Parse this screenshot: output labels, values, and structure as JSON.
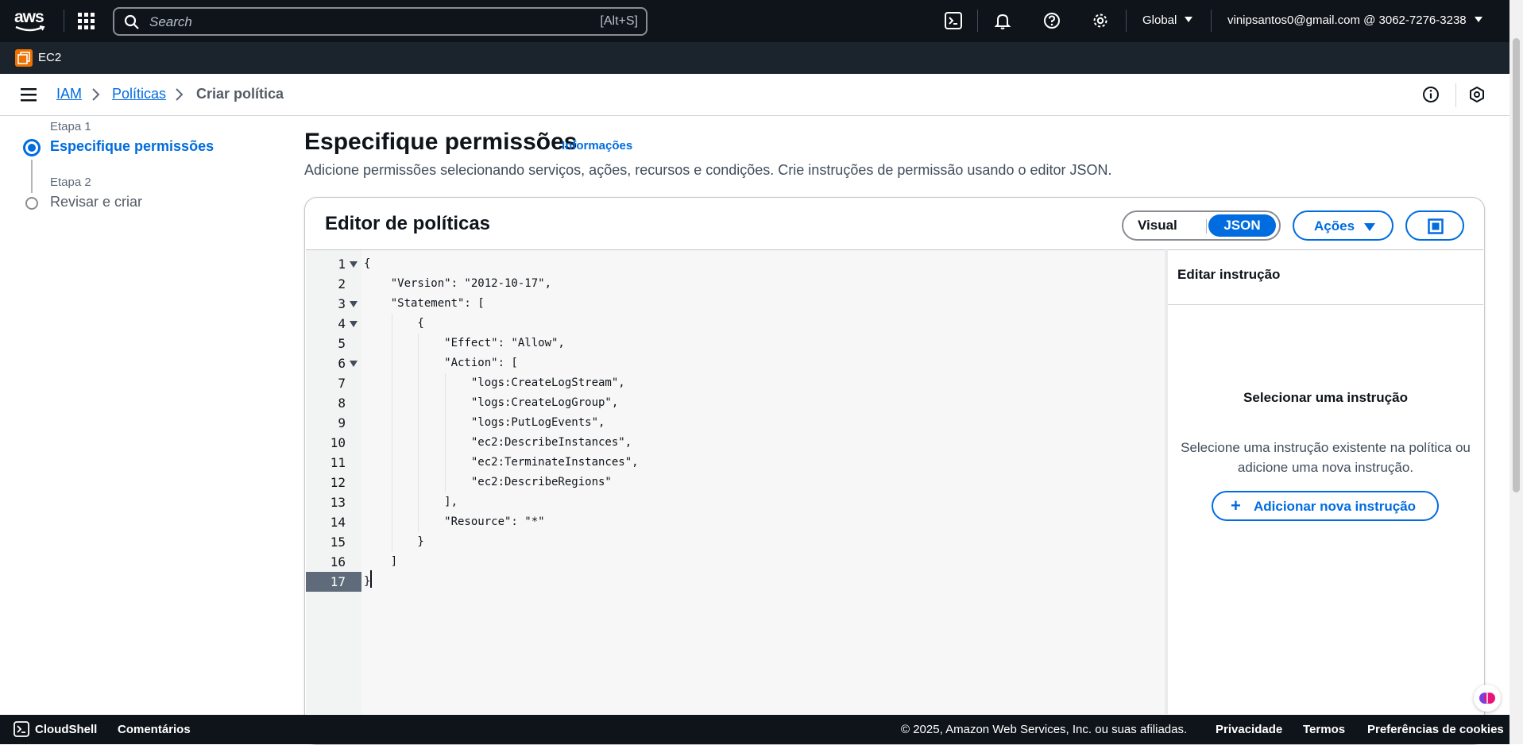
{
  "topnav": {
    "logo_text": "aws",
    "search_placeholder": "Search",
    "search_shortcut": "[Alt+S]",
    "region": "Global",
    "account": "vinipsantos0@gmail.com @ 3062-7276-3238"
  },
  "service_bar": {
    "service": "EC2"
  },
  "breadcrumb": {
    "items": [
      "IAM",
      "Políticas"
    ],
    "current": "Criar política"
  },
  "steps": [
    {
      "small": "Etapa 1",
      "title": "Especifique permissões",
      "active": true
    },
    {
      "small": "Etapa 2",
      "title": "Revisar e criar",
      "active": false
    }
  ],
  "header": {
    "title": "Especifique permissões",
    "info_link": "Informações",
    "description": "Adicione permissões selecionando serviços, ações, recursos e condições. Crie instruções de permissão usando o editor JSON."
  },
  "editor": {
    "title": "Editor de políticas",
    "mode_visual": "Visual",
    "mode_json": "JSON",
    "actions_label": "Ações",
    "lines": [
      "{",
      "    \"Version\": \"2012-10-17\",",
      "    \"Statement\": [",
      "        {",
      "            \"Effect\": \"Allow\",",
      "            \"Action\": [",
      "                \"logs:CreateLogStream\",",
      "                \"logs:CreateLogGroup\",",
      "                \"logs:PutLogEvents\",",
      "                \"ec2:DescribeInstances\",",
      "                \"ec2:TerminateInstances\",",
      "                \"ec2:DescribeRegions\"",
      "            ],",
      "            \"Resource\": \"*\"",
      "        }",
      "    ]",
      "}"
    ],
    "line_numbers": [
      "1",
      "2",
      "3",
      "4",
      "5",
      "6",
      "7",
      "8",
      "9",
      "10",
      "11",
      "12",
      "13",
      "14",
      "15",
      "16",
      "17"
    ],
    "active_line": 17,
    "foldable_lines": [
      1,
      3,
      4,
      6
    ]
  },
  "right_panel": {
    "title": "Editar instrução",
    "empty_heading": "Selecionar uma instrução",
    "empty_description": "Selecione uma instrução existente na política ou adicione uma nova instrução.",
    "add_button": "Adicionar nova instrução"
  },
  "footer": {
    "cloudshell": "CloudShell",
    "feedback": "Comentários",
    "copyright": "© 2025, Amazon Web Services, Inc. ou suas afiliadas.",
    "privacy": "Privacidade",
    "terms": "Termos",
    "cookies": "Preferências de cookies"
  },
  "colors": {
    "accent": "#006ce0",
    "nav_bg": "#0f141a",
    "service_badge": "#ed7100"
  }
}
